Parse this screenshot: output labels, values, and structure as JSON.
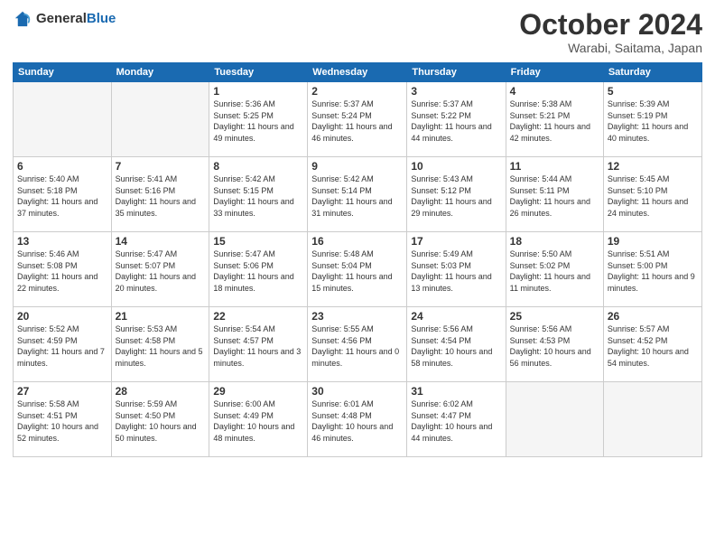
{
  "header": {
    "logo_general": "General",
    "logo_blue": "Blue",
    "month": "October 2024",
    "location": "Warabi, Saitama, Japan"
  },
  "days_of_week": [
    "Sunday",
    "Monday",
    "Tuesday",
    "Wednesday",
    "Thursday",
    "Friday",
    "Saturday"
  ],
  "weeks": [
    [
      {
        "day": "",
        "empty": true
      },
      {
        "day": "",
        "empty": true
      },
      {
        "day": "1",
        "sunrise": "5:36 AM",
        "sunset": "5:25 PM",
        "daylight": "11 hours and 49 minutes."
      },
      {
        "day": "2",
        "sunrise": "5:37 AM",
        "sunset": "5:24 PM",
        "daylight": "11 hours and 46 minutes."
      },
      {
        "day": "3",
        "sunrise": "5:37 AM",
        "sunset": "5:22 PM",
        "daylight": "11 hours and 44 minutes."
      },
      {
        "day": "4",
        "sunrise": "5:38 AM",
        "sunset": "5:21 PM",
        "daylight": "11 hours and 42 minutes."
      },
      {
        "day": "5",
        "sunrise": "5:39 AM",
        "sunset": "5:19 PM",
        "daylight": "11 hours and 40 minutes."
      }
    ],
    [
      {
        "day": "6",
        "sunrise": "5:40 AM",
        "sunset": "5:18 PM",
        "daylight": "11 hours and 37 minutes."
      },
      {
        "day": "7",
        "sunrise": "5:41 AM",
        "sunset": "5:16 PM",
        "daylight": "11 hours and 35 minutes."
      },
      {
        "day": "8",
        "sunrise": "5:42 AM",
        "sunset": "5:15 PM",
        "daylight": "11 hours and 33 minutes."
      },
      {
        "day": "9",
        "sunrise": "5:42 AM",
        "sunset": "5:14 PM",
        "daylight": "11 hours and 31 minutes."
      },
      {
        "day": "10",
        "sunrise": "5:43 AM",
        "sunset": "5:12 PM",
        "daylight": "11 hours and 29 minutes."
      },
      {
        "day": "11",
        "sunrise": "5:44 AM",
        "sunset": "5:11 PM",
        "daylight": "11 hours and 26 minutes."
      },
      {
        "day": "12",
        "sunrise": "5:45 AM",
        "sunset": "5:10 PM",
        "daylight": "11 hours and 24 minutes."
      }
    ],
    [
      {
        "day": "13",
        "sunrise": "5:46 AM",
        "sunset": "5:08 PM",
        "daylight": "11 hours and 22 minutes."
      },
      {
        "day": "14",
        "sunrise": "5:47 AM",
        "sunset": "5:07 PM",
        "daylight": "11 hours and 20 minutes."
      },
      {
        "day": "15",
        "sunrise": "5:47 AM",
        "sunset": "5:06 PM",
        "daylight": "11 hours and 18 minutes."
      },
      {
        "day": "16",
        "sunrise": "5:48 AM",
        "sunset": "5:04 PM",
        "daylight": "11 hours and 15 minutes."
      },
      {
        "day": "17",
        "sunrise": "5:49 AM",
        "sunset": "5:03 PM",
        "daylight": "11 hours and 13 minutes."
      },
      {
        "day": "18",
        "sunrise": "5:50 AM",
        "sunset": "5:02 PM",
        "daylight": "11 hours and 11 minutes."
      },
      {
        "day": "19",
        "sunrise": "5:51 AM",
        "sunset": "5:00 PM",
        "daylight": "11 hours and 9 minutes."
      }
    ],
    [
      {
        "day": "20",
        "sunrise": "5:52 AM",
        "sunset": "4:59 PM",
        "daylight": "11 hours and 7 minutes."
      },
      {
        "day": "21",
        "sunrise": "5:53 AM",
        "sunset": "4:58 PM",
        "daylight": "11 hours and 5 minutes."
      },
      {
        "day": "22",
        "sunrise": "5:54 AM",
        "sunset": "4:57 PM",
        "daylight": "11 hours and 3 minutes."
      },
      {
        "day": "23",
        "sunrise": "5:55 AM",
        "sunset": "4:56 PM",
        "daylight": "11 hours and 0 minutes."
      },
      {
        "day": "24",
        "sunrise": "5:56 AM",
        "sunset": "4:54 PM",
        "daylight": "10 hours and 58 minutes."
      },
      {
        "day": "25",
        "sunrise": "5:56 AM",
        "sunset": "4:53 PM",
        "daylight": "10 hours and 56 minutes."
      },
      {
        "day": "26",
        "sunrise": "5:57 AM",
        "sunset": "4:52 PM",
        "daylight": "10 hours and 54 minutes."
      }
    ],
    [
      {
        "day": "27",
        "sunrise": "5:58 AM",
        "sunset": "4:51 PM",
        "daylight": "10 hours and 52 minutes."
      },
      {
        "day": "28",
        "sunrise": "5:59 AM",
        "sunset": "4:50 PM",
        "daylight": "10 hours and 50 minutes."
      },
      {
        "day": "29",
        "sunrise": "6:00 AM",
        "sunset": "4:49 PM",
        "daylight": "10 hours and 48 minutes."
      },
      {
        "day": "30",
        "sunrise": "6:01 AM",
        "sunset": "4:48 PM",
        "daylight": "10 hours and 46 minutes."
      },
      {
        "day": "31",
        "sunrise": "6:02 AM",
        "sunset": "4:47 PM",
        "daylight": "10 hours and 44 minutes."
      },
      {
        "day": "",
        "empty": true
      },
      {
        "day": "",
        "empty": true
      }
    ]
  ],
  "labels": {
    "sunrise": "Sunrise:",
    "sunset": "Sunset:",
    "daylight": "Daylight:"
  }
}
